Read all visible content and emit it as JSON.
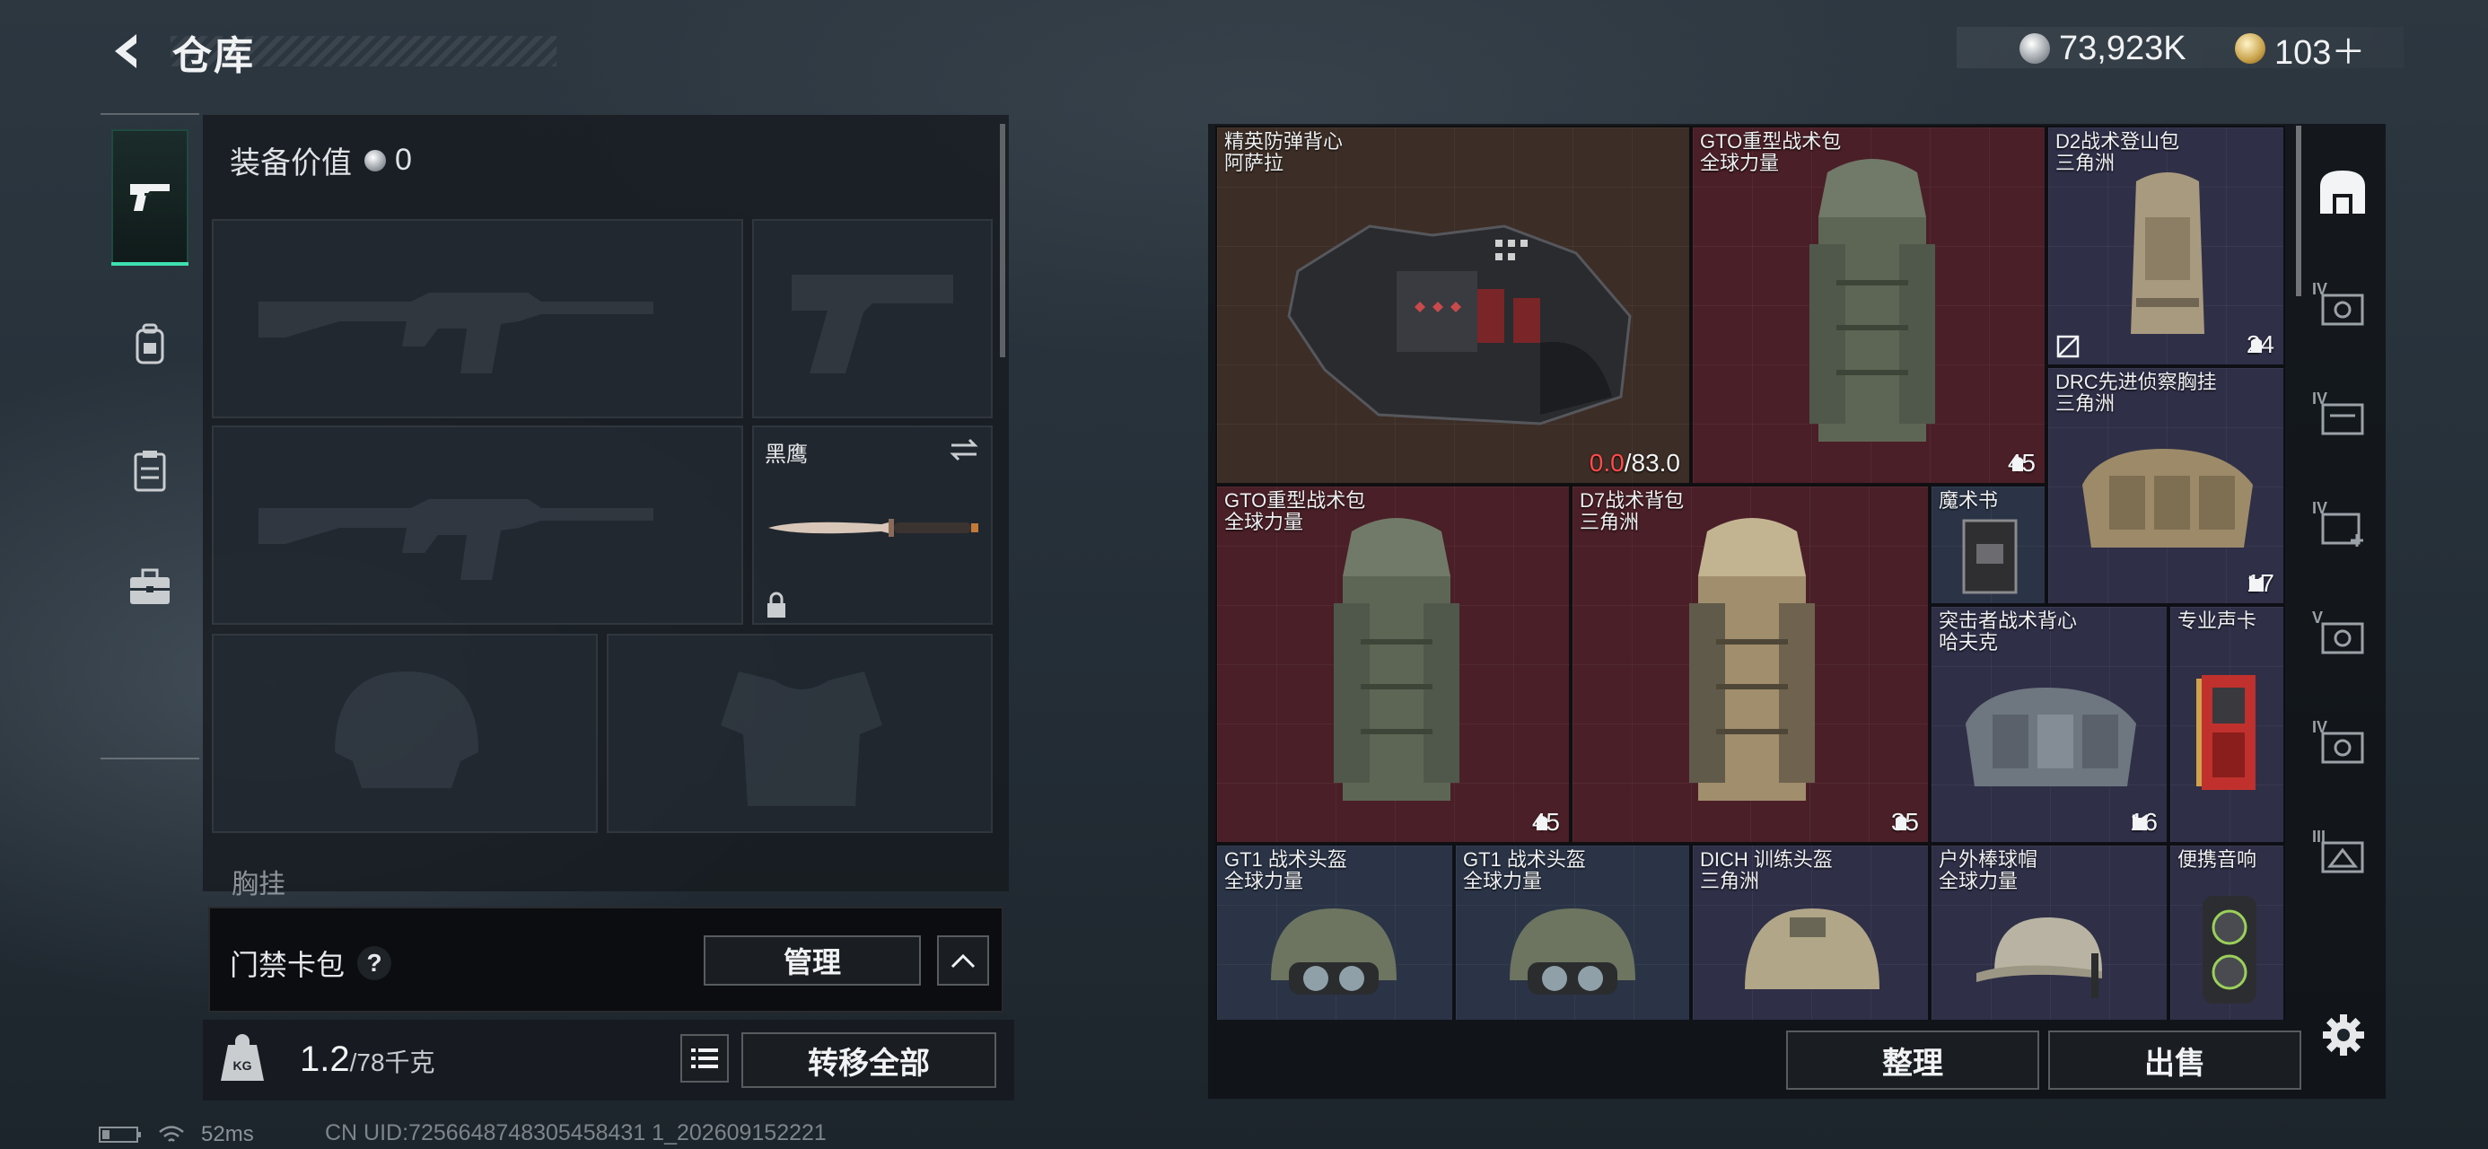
{
  "header": {
    "title": "仓库",
    "currency": [
      {
        "icon": "silver-coin-icon",
        "value": "73,923K"
      },
      {
        "icon": "gold-coin-icon",
        "value": "103＋"
      }
    ]
  },
  "left_nav": [
    {
      "icon": "pistol-icon",
      "active": true
    },
    {
      "icon": "backpack-lock-icon",
      "active": false
    },
    {
      "icon": "clipboard-icon",
      "active": false
    },
    {
      "icon": "briefcase-icon",
      "active": false
    }
  ],
  "equipment": {
    "value_label": "装备价值",
    "value": "0",
    "knife_label": "黑鹰",
    "chest_label": "胸挂",
    "chest_help": "?"
  },
  "access_card": {
    "label": "门禁卡包",
    "help": "?",
    "manage_label": "管理"
  },
  "weight": {
    "current": "1.2",
    "max": "/78千克",
    "kg_badge": "KG",
    "transfer_label": "转移全部"
  },
  "stash": {
    "items": [
      {
        "name": "精英防弹背心",
        "sub": "阿萨拉",
        "durability_current": "0.0",
        "durability_max": "/83.0"
      },
      {
        "name": "GTO重型战术包",
        "sub": "全球力量",
        "count": "45"
      },
      {
        "name": "D2战术登山包",
        "sub": "三角洲",
        "count": "24"
      },
      {
        "name": "DRC先进侦察胸挂",
        "sub": "三角洲",
        "count": "17"
      },
      {
        "name": "GTO重型战术包",
        "sub": "全球力量",
        "count": "45"
      },
      {
        "name": "D7战术背包",
        "sub": "三角洲",
        "count": "35"
      },
      {
        "name": "魔术书",
        "sub": ""
      },
      {
        "name": "突击者战术背心",
        "sub": "哈夫克",
        "count": "16"
      },
      {
        "name": "专业声卡",
        "sub": ""
      },
      {
        "name": "GT1 战术头盔",
        "sub": "全球力量"
      },
      {
        "name": "GT1 战术头盔",
        "sub": "全球力量"
      },
      {
        "name": "DICH 训练头盔",
        "sub": "三角洲"
      },
      {
        "name": "户外棒球帽",
        "sub": "全球力量"
      },
      {
        "name": "便携音响",
        "sub": ""
      }
    ],
    "organize_label": "整理",
    "sell_label": "出售"
  },
  "right_rail": [
    {
      "icon": "stash-home-icon",
      "label": ""
    },
    {
      "icon": "storage-icon",
      "label": "IV"
    },
    {
      "icon": "storage-icon",
      "label": "IV"
    },
    {
      "icon": "storage-add-icon",
      "label": "IV"
    },
    {
      "icon": "storage-icon",
      "label": "V"
    },
    {
      "icon": "storage-icon",
      "label": "IV"
    },
    {
      "icon": "storage-icon",
      "label": "III"
    }
  ],
  "status_bar": {
    "ping": "52ms",
    "uid": "CN UID:7256648748305458431 1_202609152221"
  },
  "colors": {
    "accent": "#3fe0b0",
    "red_cell": "#4a1f27",
    "purple_cell": "#2f2f48",
    "brown_cell": "#3c2e26",
    "durability_low": "#ff4b4b"
  }
}
